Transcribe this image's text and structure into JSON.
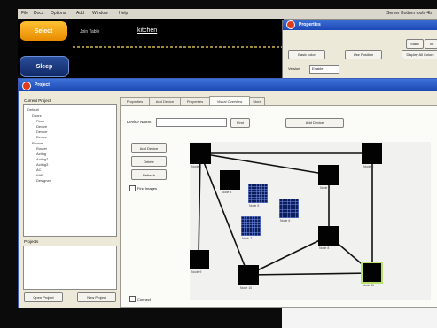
{
  "menubar": {
    "items": [
      "File",
      "Docs",
      "Options",
      "Add",
      "Window",
      "Help"
    ],
    "title": "Server Bottom tools 4b"
  },
  "dark_app": {
    "select_label": "Select",
    "sleep_label": "Sleep",
    "label": "Join Table",
    "title": "kitchen"
  },
  "properties": {
    "title": "Properties",
    "buttons": [
      "Basic color",
      "Use Position",
      "Static",
      "Sit",
      "Display All Colors"
    ],
    "version_label": "Version",
    "version_value": "Enable"
  },
  "project": {
    "title": "Project",
    "current_project_label": "Current Project",
    "tree": [
      "Default",
      "Doors",
      "Floor",
      "Device",
      "Device",
      "Device",
      "Rooms",
      "Router",
      "Acting",
      "Acting2",
      "Acting3",
      "AC",
      "Wifi",
      "Designed"
    ],
    "projects_label": "Projects",
    "open_project": "Open Project",
    "new_project": "New Project"
  },
  "tabs": [
    "Properties",
    "Add Device",
    "Properties",
    "Visual Overview",
    "Store"
  ],
  "active_tab": 3,
  "panel": {
    "device_name_label": "Device Name:",
    "find_button": "Find",
    "add_device_button": "Add Device",
    "side_buttons": [
      "Add Device",
      "Delete",
      "Refresh"
    ],
    "side_check": "Find Images",
    "bottom_check": "Connect"
  },
  "colors": {
    "select_pill": "#f6a315",
    "sleep_pill": "#1a3a80",
    "titlebar": "#2456c4",
    "selected_node_outline": "#b9e070"
  },
  "graph": {
    "nodes": [
      {
        "label": "Node 1"
      },
      {
        "label": "Node 2"
      },
      {
        "label": "Node 3"
      },
      {
        "label": "Node 4"
      },
      {
        "label": "Node 5"
      },
      {
        "label": "Node 6"
      },
      {
        "label": "Node 7"
      },
      {
        "label": "Node 8"
      },
      {
        "label": "Node 9"
      },
      {
        "label": "Node 10"
      },
      {
        "label": "Node 11"
      }
    ]
  }
}
